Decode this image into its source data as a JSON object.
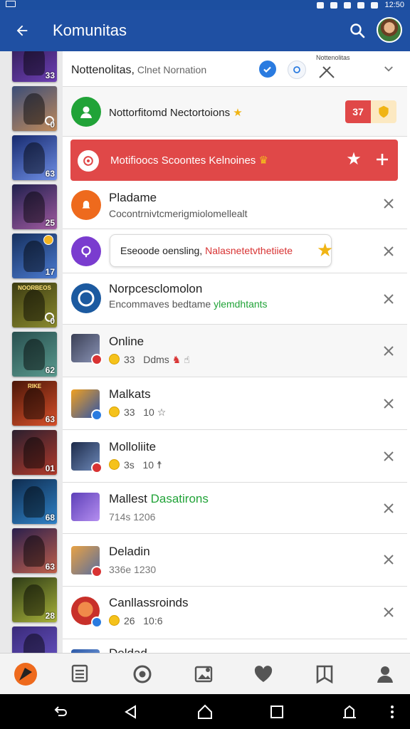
{
  "status_bar": {
    "time": "12:50"
  },
  "app_bar": {
    "title": "Komunitas"
  },
  "rail": [
    {
      "count": "33",
      "colors": [
        "#2b1a4d",
        "#6d3fb5"
      ]
    },
    {
      "count": "0",
      "colors": [
        "#3b4d78",
        "#c08a5a"
      ]
    },
    {
      "count": "63",
      "colors": [
        "#172a6e",
        "#6f8fe6"
      ]
    },
    {
      "count": "25",
      "colors": [
        "#20204d",
        "#a05aa0"
      ]
    },
    {
      "count": "17",
      "colors": [
        "#16305e",
        "#4a7ad0"
      ]
    },
    {
      "count": "0",
      "colors": [
        "#3b3a12",
        "#8a8a2e"
      ],
      "tag": "NOORBEOS"
    },
    {
      "count": "62",
      "colors": [
        "#284f4f",
        "#5a9a8e"
      ]
    },
    {
      "count": "63",
      "colors": [
        "#4a1608",
        "#d8502a"
      ],
      "tag": "RIKE"
    },
    {
      "count": "01",
      "colors": [
        "#2a1f2f",
        "#b23a2a"
      ]
    },
    {
      "count": "68",
      "colors": [
        "#0f2c4f",
        "#2f82c7"
      ]
    },
    {
      "count": "63",
      "colors": [
        "#2a1f4d",
        "#c0604a"
      ]
    },
    {
      "count": "28",
      "colors": [
        "#2c3a16",
        "#a8b23a"
      ]
    },
    {
      "count": "",
      "colors": [
        "#3a2a7a",
        "#6a56c8"
      ]
    }
  ],
  "rows": [
    {
      "title": "Nottenolitas,",
      "title_rest": " Clnet Nornation",
      "right_text": "Nottenolitas"
    },
    {
      "title": "Nottorfitomd Nectortoions",
      "badge_text": "37"
    },
    {
      "title": "Motifioocs Scoontes Kelnoines"
    },
    {
      "title": "Pladame",
      "subtitle": "Cocontrnivtcmerigmiolomellealt"
    },
    {
      "bubble_a": "Eseoode oensling,",
      "bubble_b": "Nalasnetetvthetiiete"
    },
    {
      "title": "Norpcesclomolon",
      "subtitle_a": "Encommaves bedtame",
      "subtitle_b": "ylemdhtants"
    },
    {
      "title": "Online",
      "count": "33",
      "extra": "Ddms"
    },
    {
      "title": "Malkats",
      "count": "33",
      "extra": "10"
    },
    {
      "title": "Molloliite",
      "count": "3s",
      "extra": "10"
    },
    {
      "title_a": "Mallest",
      "title_b": "Dasatirons",
      "subtitle": "714s 1206"
    },
    {
      "title": "Deladin",
      "subtitle": "336e 1230"
    },
    {
      "title": "Canllassroinds",
      "count": "26",
      "extra": "10:6"
    },
    {
      "title": "Deldad"
    }
  ],
  "icons": {
    "back": "arrow-left-icon",
    "search": "search-icon",
    "close": "close-icon",
    "nav": [
      "home-icon",
      "news-icon",
      "gallery-icon",
      "photo-icon",
      "heart-icon",
      "bookmark-icon",
      "profile-icon"
    ],
    "sys": [
      "rotate-icon",
      "back-triangle-icon",
      "home-circle-icon",
      "recents-square-icon",
      "screenshot-icon",
      "more-icon"
    ]
  },
  "colors": {
    "brand": "#1f50a3",
    "green": "#21a338",
    "red": "#e04848",
    "purple": "#7a3ccf",
    "orange": "#ee6a1d"
  }
}
